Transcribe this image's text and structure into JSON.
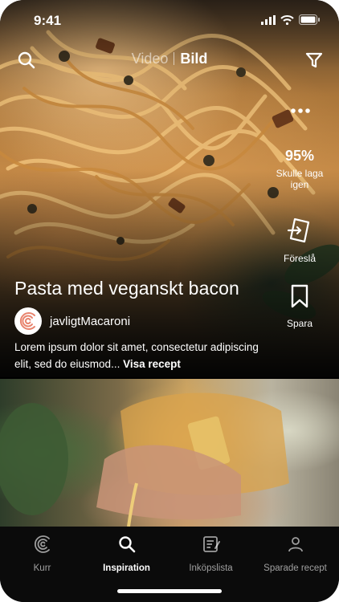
{
  "status_bar": {
    "time": "9:41"
  },
  "top_nav": {
    "tabs": [
      {
        "label": "Video",
        "active": false
      },
      {
        "label": "Bild",
        "active": true
      }
    ]
  },
  "recipe": {
    "title": "Pasta med veganskt bacon",
    "author": "javligtMacaroni",
    "description": "Lorem ipsum dolor sit amet, consectetur adipiscing elit, sed do eiusmod...",
    "read_more_label": "Visa recept"
  },
  "actions": {
    "rating_value": "95%",
    "rating_label": "Skulle laga igen",
    "suggest_label": "Föreslå",
    "save_label": "Spara"
  },
  "tabbar": {
    "items": [
      {
        "label": "Kurr",
        "icon": "kurr-logo-icon",
        "active": false
      },
      {
        "label": "Inspiration",
        "icon": "search-icon",
        "active": true
      },
      {
        "label": "Inköpslista",
        "icon": "shopping-list-icon",
        "active": false
      },
      {
        "label": "Sparade recept",
        "icon": "user-icon",
        "active": false
      }
    ]
  },
  "colors": {
    "background": "#000000",
    "text": "#ffffff",
    "inactive_text": "#9a9a9a",
    "brand_avatar": "#e8846e"
  }
}
